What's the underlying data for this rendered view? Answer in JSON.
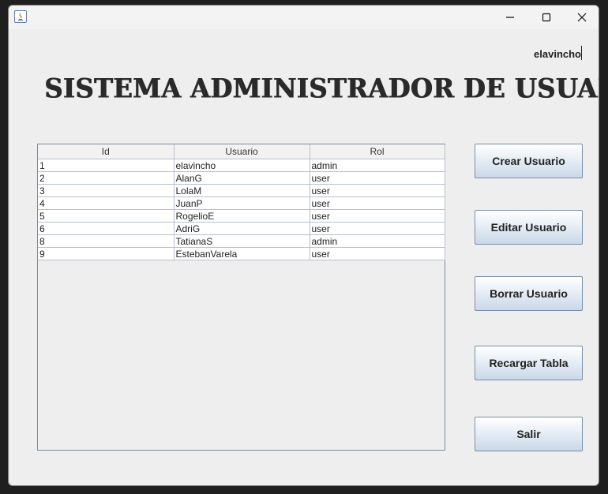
{
  "window": {
    "username": "elavincho",
    "title": "SISTEMA ADMINISTRADOR DE USUARIOS"
  },
  "table": {
    "columns": [
      "Id",
      "Usuario",
      "Rol"
    ],
    "rows": [
      [
        "1",
        "elavincho",
        "admin"
      ],
      [
        "2",
        "AlanG",
        "user"
      ],
      [
        "3",
        "LolaM",
        "user"
      ],
      [
        "4",
        "JuanP",
        "user"
      ],
      [
        "5",
        "RogelioE",
        "user"
      ],
      [
        "6",
        "AdriG",
        "user"
      ],
      [
        "8",
        "TatianaS",
        "admin"
      ],
      [
        "9",
        "EstebanVarela",
        "user"
      ]
    ]
  },
  "buttons": {
    "crear": "Crear Usuario",
    "editar": "Editar Usuario",
    "borrar": "Borrar Usuario",
    "recargar": "Recargar Tabla",
    "salir": "Salir"
  },
  "icons": {
    "app": "java-app-icon",
    "minimize": "minimize-icon",
    "maximize": "maximize-icon",
    "close": "close-icon"
  }
}
